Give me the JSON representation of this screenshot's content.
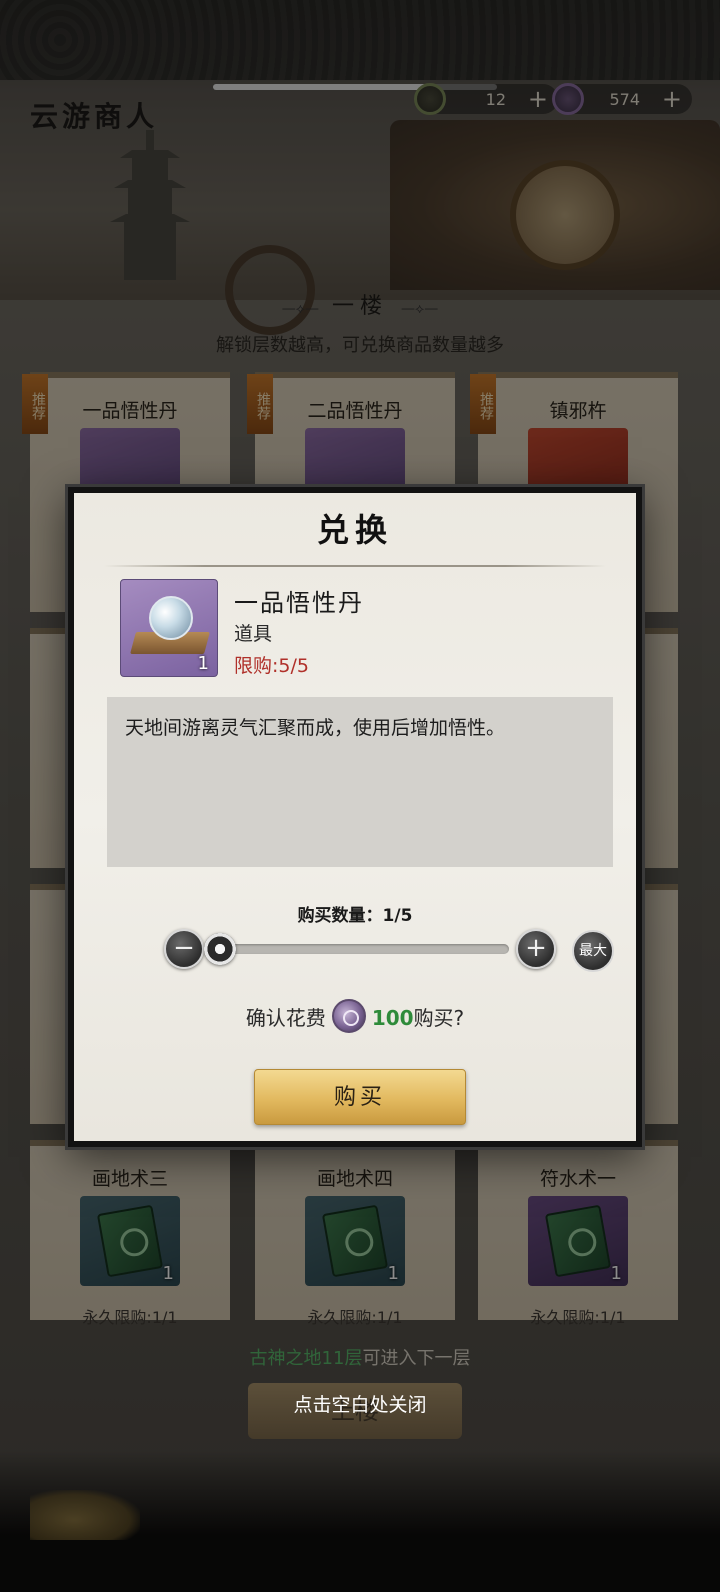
{
  "header": {
    "title": "云游商人",
    "resources": [
      {
        "icon": "jade-token-icon",
        "value": "12",
        "plus": "+"
      },
      {
        "icon": "spirit-coin-icon",
        "value": "574",
        "plus": "+"
      }
    ]
  },
  "floor": {
    "name": "一楼",
    "hint": "解锁层数越高，可兑换商品数量越多"
  },
  "shop_cards_top": [
    {
      "title": "一品悟性丹",
      "tag": "推荐",
      "color": "purple"
    },
    {
      "title": "二品悟性丹",
      "tag": "推荐",
      "color": "purple"
    },
    {
      "title": "镇邪杵",
      "tag": "推荐",
      "color": "red"
    }
  ],
  "shop_cards_bottom": [
    {
      "title": "画地术三",
      "count": "1",
      "limit": "永久限购:1/1"
    },
    {
      "title": "画地术四",
      "count": "1",
      "limit": "永久限购:1/1"
    },
    {
      "title": "符水术一",
      "count": "1",
      "limit": "永久限购:1/1"
    }
  ],
  "footer": {
    "requirement_highlight": "古神之地11层",
    "requirement_rest": "可进入下一层",
    "up_button": "上楼",
    "close_hint": "点击空白处关闭"
  },
  "modal": {
    "title": "兑换",
    "item": {
      "name": "一品悟性丹",
      "type": "道具",
      "limit": "限购:5/5",
      "count": "1",
      "description": "天地间游离灵气汇聚而成，使用后增加悟性。"
    },
    "quantity_label": "购买数量：1/5",
    "quantity": {
      "current": 1,
      "max": 5
    },
    "minus": "−",
    "plus": "+",
    "max_label": "最大",
    "confirm_prefix": "确认花费",
    "cost_value": "100",
    "confirm_suffix": "购买?",
    "buy_label": "购买"
  }
}
